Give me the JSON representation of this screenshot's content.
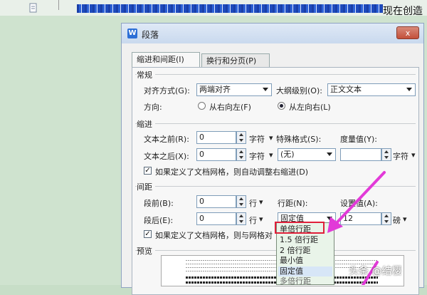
{
  "background": {
    "doc_text": "现在创造",
    "watermark": "头条 @结樱"
  },
  "dialog": {
    "title": "段落",
    "app_icon_letter": "W",
    "close_label": "x",
    "tabs": [
      {
        "label": "缩进和间距(I)",
        "active": true
      },
      {
        "label": "换行和分页(P)",
        "active": false
      }
    ]
  },
  "general": {
    "section": "常规",
    "align_label": "对齐方式(G):",
    "align_value": "两端对齐",
    "outline_label": "大纲级别(O):",
    "outline_value": "正文文本",
    "direction_label": "方向:",
    "rtl_label": "从右向左(F)",
    "ltr_label": "从左向右(L)",
    "direction_selected": "ltr"
  },
  "indent": {
    "section": "缩进",
    "before_label": "文本之前(R):",
    "before_value": "0",
    "before_unit": "字符",
    "after_label": "文本之后(X):",
    "after_value": "0",
    "after_unit": "字符",
    "special_label": "特殊格式(S):",
    "special_value": "(无)",
    "measure_label": "度量值(Y):",
    "measure_value": "",
    "measure_unit": "字符",
    "auto_adjust_label": "如果定义了文档网格，则自动调整右缩进(D)",
    "auto_adjust_checked": true
  },
  "spacing": {
    "section": "间距",
    "before_label": "段前(B):",
    "before_value": "0",
    "before_unit": "行",
    "after_label": "段后(E):",
    "after_value": "0",
    "after_unit": "行",
    "line_label": "行距(N):",
    "line_value": "固定值",
    "set_label": "设置值(A):",
    "set_value": "12",
    "set_unit": "磅",
    "grid_label": "如果定义了文档网格，则与网格对",
    "grid_checked": true,
    "line_options": [
      "单倍行距",
      "1.5 倍行距",
      "2 倍行距",
      "最小值",
      "固定值",
      "多倍行距"
    ],
    "line_highlighted": "单倍行距",
    "line_hover": "固定值"
  },
  "preview": {
    "section": "预览"
  },
  "colors": {
    "highlight_box": "#e0203a",
    "arrow": "#e23ad8"
  }
}
